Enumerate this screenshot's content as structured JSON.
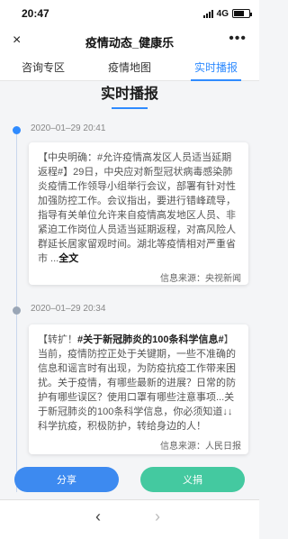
{
  "status": {
    "time": "20:47",
    "network": "4G"
  },
  "nav": {
    "title": "疫情动态_健康乐",
    "close_icon": "×",
    "more_icon": "•••"
  },
  "tabs": [
    {
      "label": "咨询专区"
    },
    {
      "label": "疫情地图"
    },
    {
      "label": "实时播报"
    }
  ],
  "section_title": "实时播报",
  "posts": [
    {
      "time": "2020–01–29 20:41",
      "text": "【中央明确：#允许疫情高发区人员适当延期返程#】29日，中央应对新型冠状病毒感染肺炎疫情工作领导小组举行会议，部署有针对性加强防控工作。会议指出，要进行错峰疏导，指导有关单位允许来自疫情高发地区人员、非紧迫工作岗位人员适当延期返程，对高风险人群延长居家留观时间。湖北等疫情相对严重省市 ...",
      "full_link": "全文",
      "source": "信息来源：央视新闻"
    },
    {
      "time": "2020–01–29 20:34",
      "prefix": "【转扩！",
      "headline": "#关于新冠肺炎的100条科学信息#",
      "text": "】当前，疫情防控正处于关键期，一些不准确的信息和谣言时有出现，为防疫抗疫工作带来困扰。关于疫情，有哪些最新的进展？日常的防护有哪些误区？使用口罩有哪些注意事项...关于新冠肺炎的100条科学信息，你必须知道↓↓科学抗疫，积极防护，转给身边的人！",
      "source": "信息来源：人民日报"
    }
  ],
  "buttons": {
    "share": "分享",
    "donate": "义捐"
  },
  "browser": {
    "back_icon": "‹",
    "forward_icon": "›"
  }
}
